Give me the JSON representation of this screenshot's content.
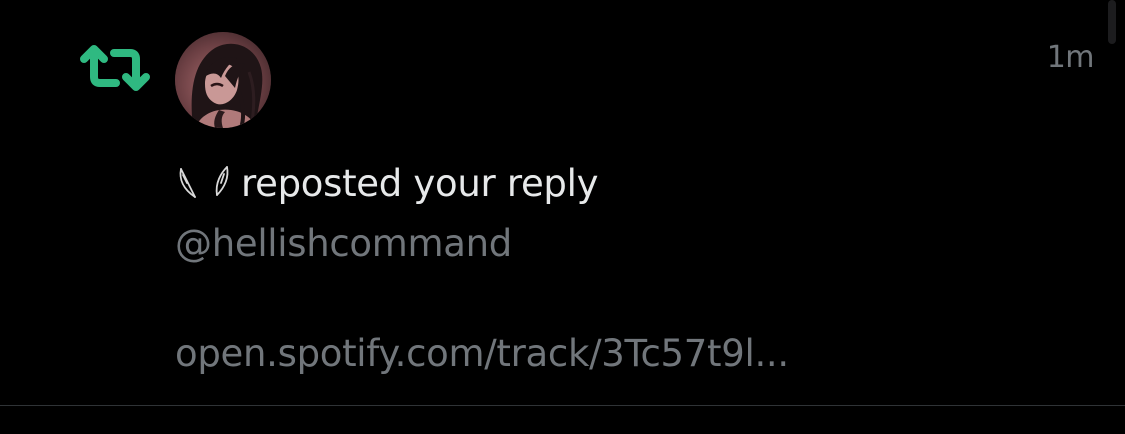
{
  "notification": {
    "type_icon": "repost-icon",
    "avatar_icon": "anime-character-avatar",
    "actor_name_icon": "angel-wings-icon",
    "action_text": "reposted your reply",
    "timestamp": "1m",
    "handle": "@hellishcommand",
    "link_text": "open.spotify.com/track/3Tc57t9l..."
  },
  "colors": {
    "background": "#000000",
    "repost_green": "#00ba7c",
    "primary_text": "#e7e9ea",
    "secondary_text": "#71767b",
    "divider": "#2f3336"
  }
}
